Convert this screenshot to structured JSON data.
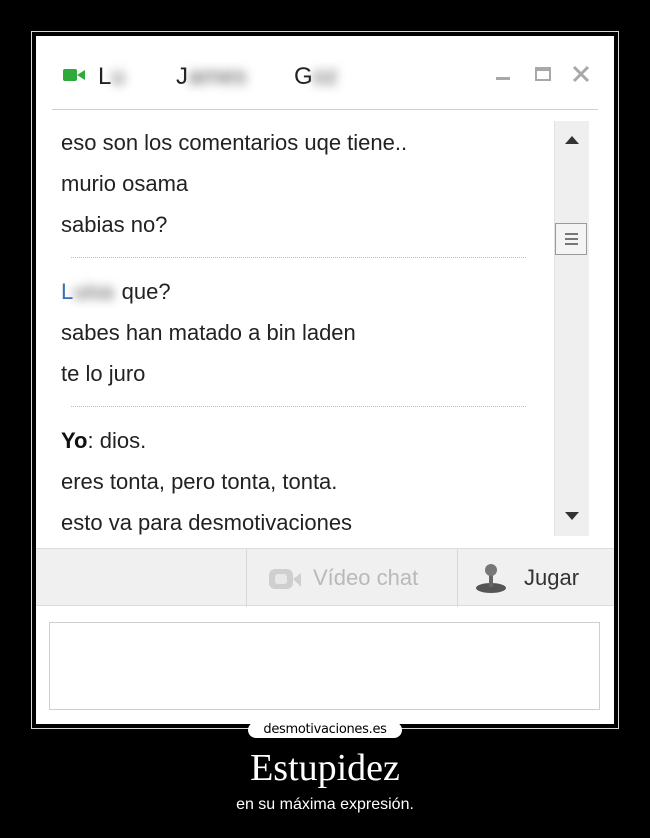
{
  "window": {
    "title_parts": [
      "L",
      "J",
      "G"
    ],
    "controls": [
      "minimize",
      "maximize",
      "close"
    ]
  },
  "messages": {
    "group1": [
      "eso son los comentarios uqe tiene..",
      "murio osama",
      "sabias no?"
    ],
    "group2": {
      "sender": "L",
      "first": "que?",
      "lines": [
        "sabes han matado a bin laden",
        "te lo juro"
      ]
    },
    "group3": {
      "sender": "Yo",
      "separator": ":",
      "first": " dios.",
      "lines": [
        "eres tonta, pero tonta, tonta.",
        "esto va para desmotivaciones"
      ]
    }
  },
  "toolbar": {
    "video_chat_label": "Vídeo chat",
    "jugar_label": "Jugar"
  },
  "poster": {
    "logo_text": "desmotivaciones.es",
    "title": "Estupidez",
    "subtitle": "en su máxima expresión."
  },
  "colors": {
    "sender_link": "#3b6fb6",
    "cam_icon": "#2eaa3a"
  }
}
